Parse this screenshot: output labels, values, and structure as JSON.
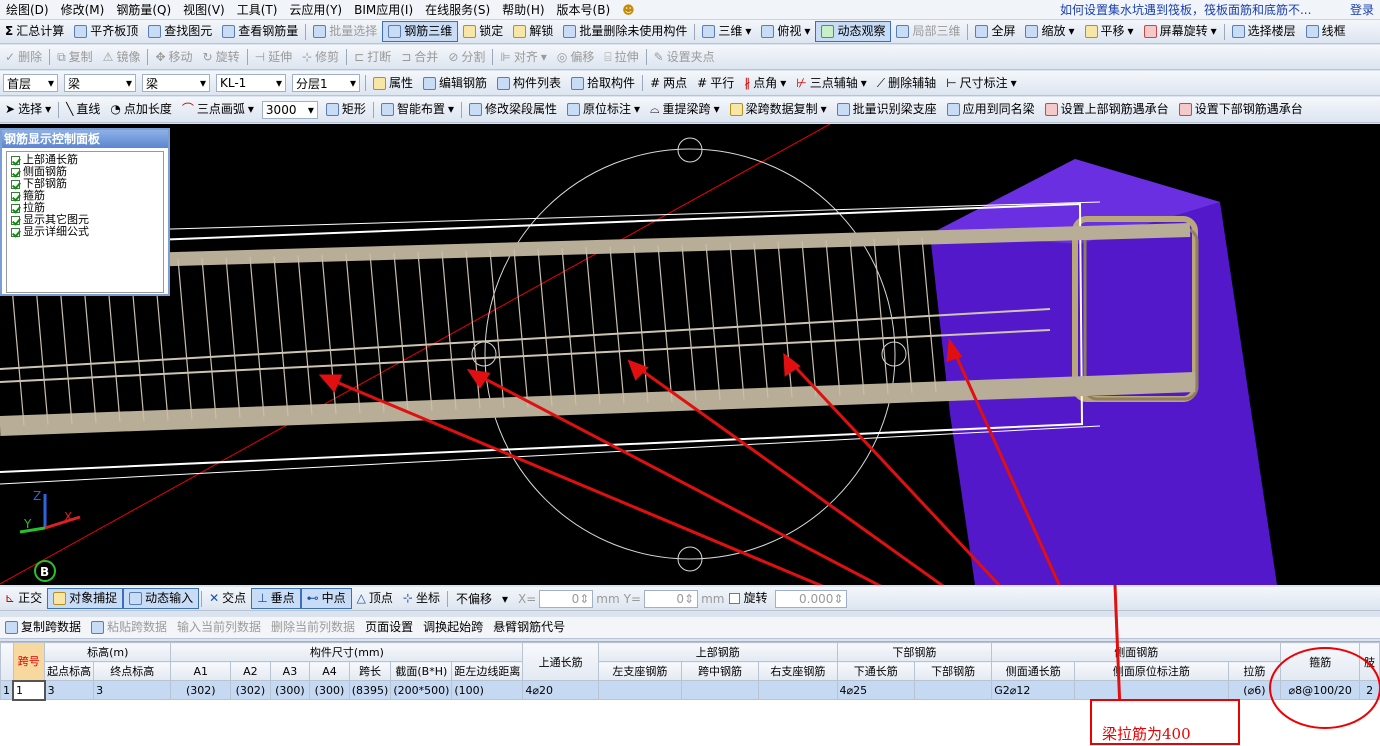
{
  "menu": [
    "绘图(D)",
    "修改(M)",
    "钢筋量(Q)",
    "视图(V)",
    "工具(T)",
    "云应用(Y)",
    "BIM应用(I)",
    "在线服务(S)",
    "帮助(H)",
    "版本号(B)"
  ],
  "menu_right": {
    "news": "如何设置集水坑遇到筏板，筏板面筋和底筋不...",
    "login": "登录"
  },
  "toolbar1": [
    "汇总计算",
    "平齐板顶",
    "查找图元",
    "查看钢筋量",
    "批量选择",
    "钢筋三维",
    "锁定",
    "解锁",
    "批量删除未使用构件",
    "三维",
    "俯视",
    "动态观察",
    "局部三维",
    "全屏",
    "缩放",
    "平移",
    "屏幕旋转",
    "选择楼层",
    "线框"
  ],
  "toolbar2": [
    "删除",
    "复制",
    "镜像",
    "移动",
    "旋转",
    "延伸",
    "修剪",
    "打断",
    "合并",
    "分割",
    "对齐",
    "偏移",
    "拉伸",
    "设置夹点"
  ],
  "toolbar3": {
    "floor": "首层",
    "type": "梁",
    "subtype": "梁",
    "component": "KL-1",
    "layer": "分层1",
    "items": [
      "属性",
      "编辑钢筋",
      "构件列表",
      "拾取构件",
      "两点",
      "平行",
      "点角",
      "三点辅轴",
      "删除辅轴",
      "尺寸标注"
    ]
  },
  "toolbar4": {
    "select": "选择",
    "items": [
      "直线",
      "点加长度",
      "三点画弧"
    ],
    "arc_value": "3000",
    "items2": [
      "矩形",
      "智能布置",
      "修改梁段属性",
      "原位标注",
      "重提梁跨",
      "梁跨数据复制",
      "批量识别梁支座",
      "应用到同名梁",
      "设置上部钢筋遇承台",
      "设置下部钢筋遇承台"
    ]
  },
  "panel": {
    "title": "钢筋显示控制面板",
    "options": [
      "上部通长筋",
      "侧面钢筋",
      "下部钢筋",
      "箍筋",
      "拉筋",
      "显示其它图元",
      "显示详细公式"
    ]
  },
  "axis": {
    "x": "X",
    "y": "Y",
    "z": "Z",
    "badge": "B"
  },
  "snapbar": {
    "items": [
      "正交",
      "对象捕捉",
      "动态输入",
      "交点",
      "垂点",
      "中点",
      "顶点",
      "坐标"
    ],
    "offset": "不偏移",
    "x_label": "X=",
    "x_value": "0",
    "unit": "mm",
    "y_label": "Y=",
    "y_value": "0",
    "rotate": "旋转",
    "rotate_value": "0.000"
  },
  "tablebar": [
    "复制跨数据",
    "粘贴跨数据",
    "输入当前列数据",
    "删除当前列数据",
    "页面设置",
    "调换起始跨",
    "悬臂钢筋代号"
  ],
  "table": {
    "group_headers": {
      "span": "跨号",
      "elevation": "标高(m)",
      "size": "构件尺寸(mm)",
      "top_through": "上通长筋",
      "top": "上部钢筋",
      "bottom": "下部钢筋",
      "side": "侧面钢筋",
      "stirrup": "箍筋",
      "legs": "肢"
    },
    "sub_headers": [
      "起点标高",
      "终点标高",
      "A1",
      "A2",
      "A3",
      "A4",
      "跨长",
      "截面(B*H)",
      "距左边线距离",
      "左支座钢筋",
      "跨中钢筋",
      "右支座钢筋",
      "下通长筋",
      "下部钢筋",
      "侧面通长筋",
      "侧面原位标注筋",
      "拉筋"
    ],
    "row": {
      "index": "1",
      "span": "1",
      "start": "3",
      "end": "3",
      "a1": "(302)",
      "a2": "(302)",
      "a3": "(300)",
      "a4": "(300)",
      "length": "(8395)",
      "section": "(200*500)",
      "dist": "(100)",
      "top_through": "4⌀20",
      "left": "",
      "mid": "",
      "right": "",
      "bottom_through": "4⌀25",
      "bottom": "",
      "side_through": "G2⌀12",
      "side_local": "",
      "tie": "(⌀6)",
      "stirrup": "⌀8@100/20",
      "legs": "2"
    }
  },
  "callout": "梁拉筋为400",
  "colors": {
    "accent": "#e00000",
    "column": "#5a1fd0",
    "background": "#000000"
  }
}
